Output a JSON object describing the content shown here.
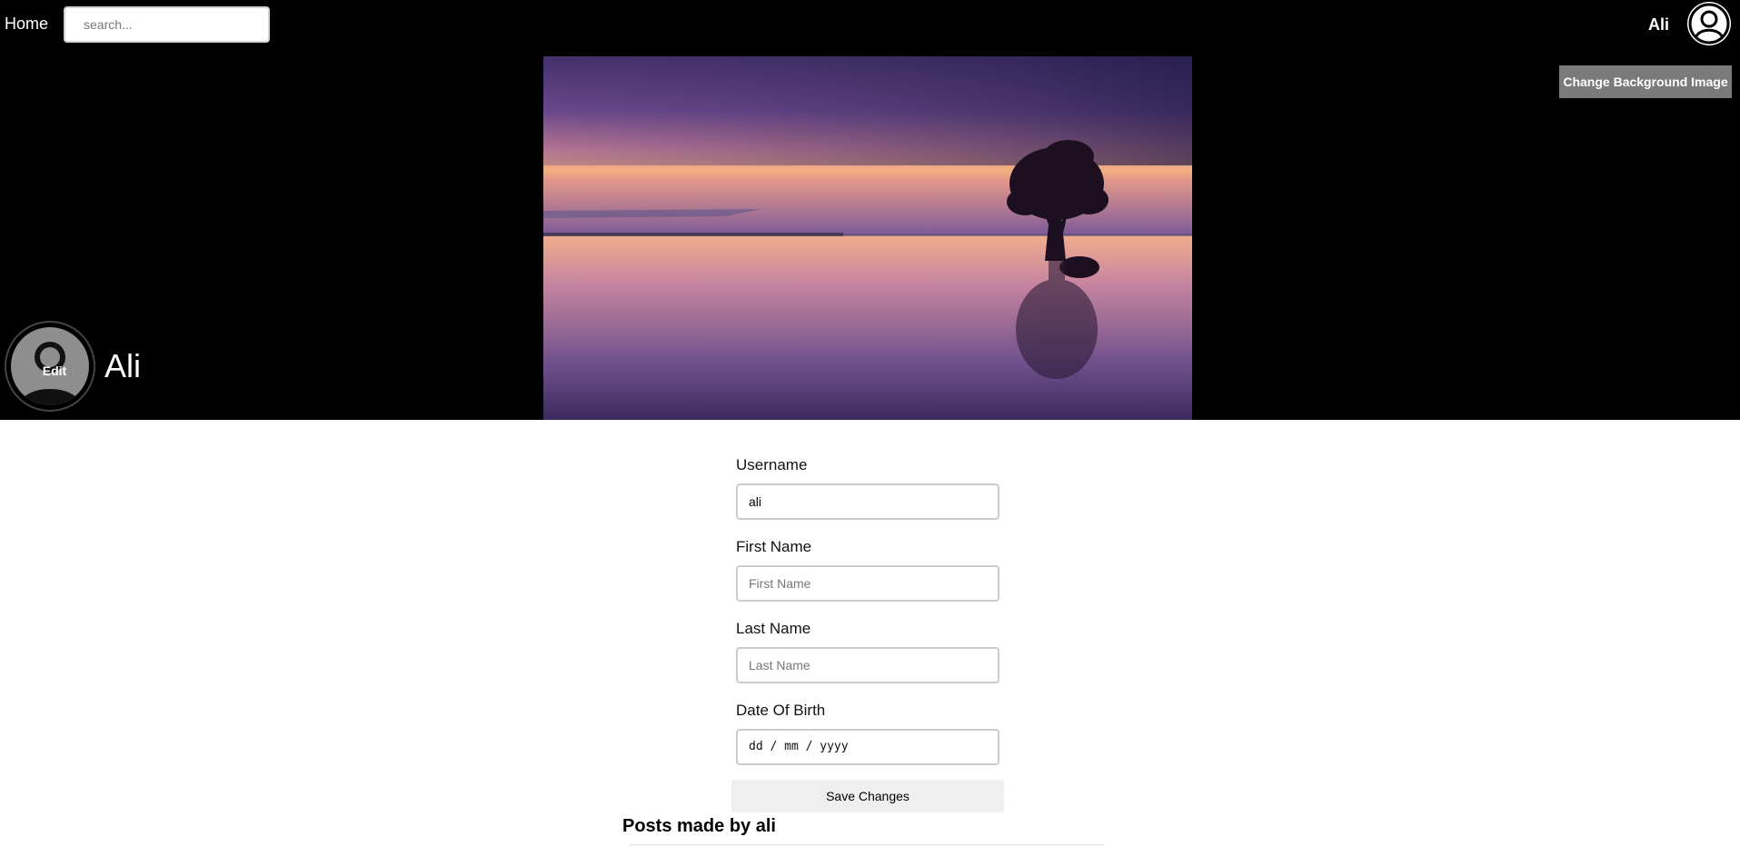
{
  "nav": {
    "home_label": "Home",
    "search_placeholder": "search...",
    "user_name": "Ali",
    "user_avatar_icon": "user-circle-icon"
  },
  "hero": {
    "change_bg_label": "Change Background Image",
    "profile_edit_label": "Edit",
    "profile_name": "Ali",
    "profile_icon": "user-silhouette-icon",
    "cover_image": "sunset-lake-tree-photo"
  },
  "form": {
    "username_label": "Username",
    "username_value": "ali",
    "first_name_label": "First Name",
    "first_name_placeholder": "First Name",
    "last_name_label": "Last Name",
    "last_name_placeholder": "Last Name",
    "dob_label": "Date Of Birth",
    "dob_placeholder": "dd / mm / yyyy",
    "save_label": "Save Changes"
  },
  "posts": {
    "title": "Posts made by ali"
  },
  "colors": {
    "header_bg": "#000000",
    "button_gray": "#7a7a7a",
    "save_bg": "#efefef"
  }
}
